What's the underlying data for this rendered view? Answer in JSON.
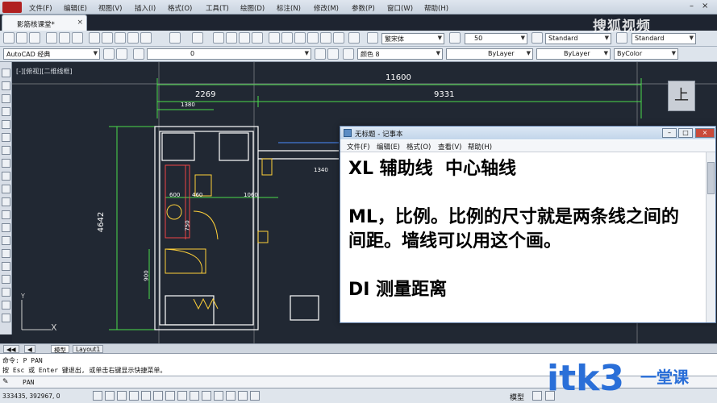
{
  "app": {
    "doc_tab": "影筋核课堂*",
    "menus": [
      "文件(F)",
      "编辑(E)",
      "视图(V)",
      "插入(I)",
      "格式(O)",
      "工具(T)",
      "绘图(D)",
      "标注(N)",
      "修改(M)",
      "参数(P)",
      "窗口(W)",
      "帮助(H)"
    ]
  },
  "toolbar": {
    "workspace": "AutoCAD 经典",
    "layer": "0",
    "text_style": "繁宋体",
    "text_height": "50",
    "dim_style": "Standard",
    "table_style": "Standard",
    "color": "颜色 8",
    "linetype": "ByLayer",
    "lineweight": "ByLayer",
    "plotstyle": "ByColor"
  },
  "viewport": {
    "label": "[-][俯视][二维线框]",
    "viewcube": "上",
    "ucs_x": "X",
    "ucs_y": "Y"
  },
  "dimensions": {
    "d1": "11600",
    "d2": "2269",
    "d3": "9331",
    "d4": "1380",
    "d5": "4642",
    "d6": "1060",
    "d7": "600",
    "d8": "460",
    "d9": "1340",
    "d10": "900",
    "d11": "750"
  },
  "tabs": {
    "model": "模型",
    "layout1": "Layout1"
  },
  "command": {
    "line1": "命令: P PAN",
    "line2": "按 Esc 或 Enter 键退出, 或单击右键显示快捷菜单。",
    "input": "PAN"
  },
  "status": {
    "coords": "333435, 392967, 0",
    "model": "模型"
  },
  "notepad": {
    "title": "无标题 - 记事本",
    "menus": [
      "文件(F)",
      "编辑(E)",
      "格式(O)",
      "查看(V)",
      "帮助(H)"
    ],
    "text": "XL 辅助线  中心轴线\n\nML，比例。比例的尺寸就是两条线之间的间距。墙线可以用这个画。\n\nDI 测量距离"
  },
  "watermarks": {
    "top": "搜狐视频",
    "bottom_logo": "itk3",
    "bottom_text": "一堂课"
  }
}
